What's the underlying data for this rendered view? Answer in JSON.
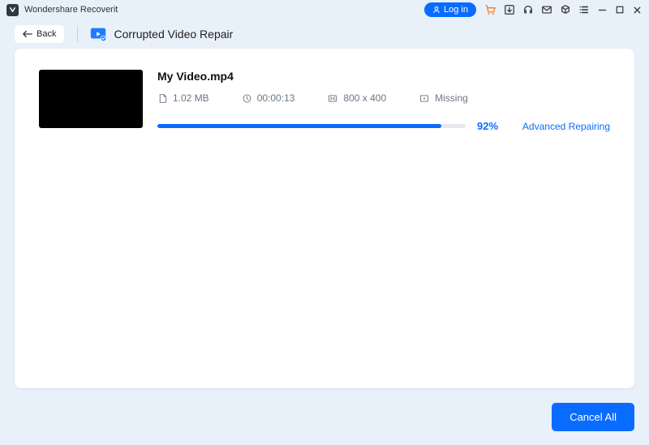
{
  "app": {
    "name": "Wondershare Recoverit"
  },
  "titlebar": {
    "login": "Log in"
  },
  "header": {
    "back": "Back",
    "feature": "Corrupted Video Repair"
  },
  "repair": {
    "items": [
      {
        "name": "My Video.mp4",
        "size": "1.02  MB",
        "duration": "00:00:13",
        "resolution": "800 x 400",
        "location": "Missing",
        "progress_pct": 92,
        "progress_label": "92%",
        "status": "Advanced Repairing"
      }
    ]
  },
  "footer": {
    "cancel_all": "Cancel All"
  }
}
